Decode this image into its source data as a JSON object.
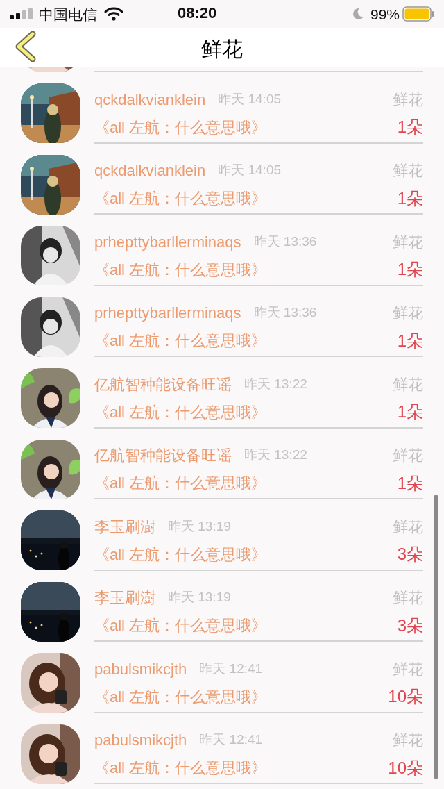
{
  "status_bar": {
    "carrier": "中国电信",
    "time": "08:20",
    "battery": "99%"
  },
  "nav": {
    "title": "鲜花"
  },
  "rows": [
    {
      "name": "qckdalkvianklein",
      "time": "昨天 14:05",
      "gift": "鲜花",
      "message": "《all 左航：什么意思哦》",
      "count": "1朵"
    },
    {
      "name": "qckdalkvianklein",
      "time": "昨天 14:05",
      "gift": "鲜花",
      "message": "《all 左航：什么意思哦》",
      "count": "1朵"
    },
    {
      "name": "prhepttybarllerminaqs",
      "time": "昨天 13:36",
      "gift": "鲜花",
      "message": "《all 左航：什么意思哦》",
      "count": "1朵"
    },
    {
      "name": "prhepttybarllerminaqs",
      "time": "昨天 13:36",
      "gift": "鲜花",
      "message": "《all 左航：什么意思哦》",
      "count": "1朵"
    },
    {
      "name": "亿航智种能设备旺谣",
      "time": "昨天 13:22",
      "gift": "鲜花",
      "message": "《all 左航：什么意思哦》",
      "count": "1朵"
    },
    {
      "name": "亿航智种能设备旺谣",
      "time": "昨天 13:22",
      "gift": "鲜花",
      "message": "《all 左航：什么意思哦》",
      "count": "1朵"
    },
    {
      "name": "李玉刷澍",
      "time": "昨天 13:19",
      "gift": "鲜花",
      "message": "《all 左航：什么意思哦》",
      "count": "3朵"
    },
    {
      "name": "李玉刷澍",
      "time": "昨天 13:19",
      "gift": "鲜花",
      "message": "《all 左航：什么意思哦》",
      "count": "3朵"
    },
    {
      "name": "pabulsmikcjth",
      "time": "昨天 12:41",
      "gift": "鲜花",
      "message": "《all 左航：什么意思哦》",
      "count": "10朵"
    },
    {
      "name": "pabulsmikcjth",
      "time": "昨天 12:41",
      "gift": "鲜花",
      "message": "《all 左航：什么意思哦》",
      "count": "10朵"
    }
  ]
}
